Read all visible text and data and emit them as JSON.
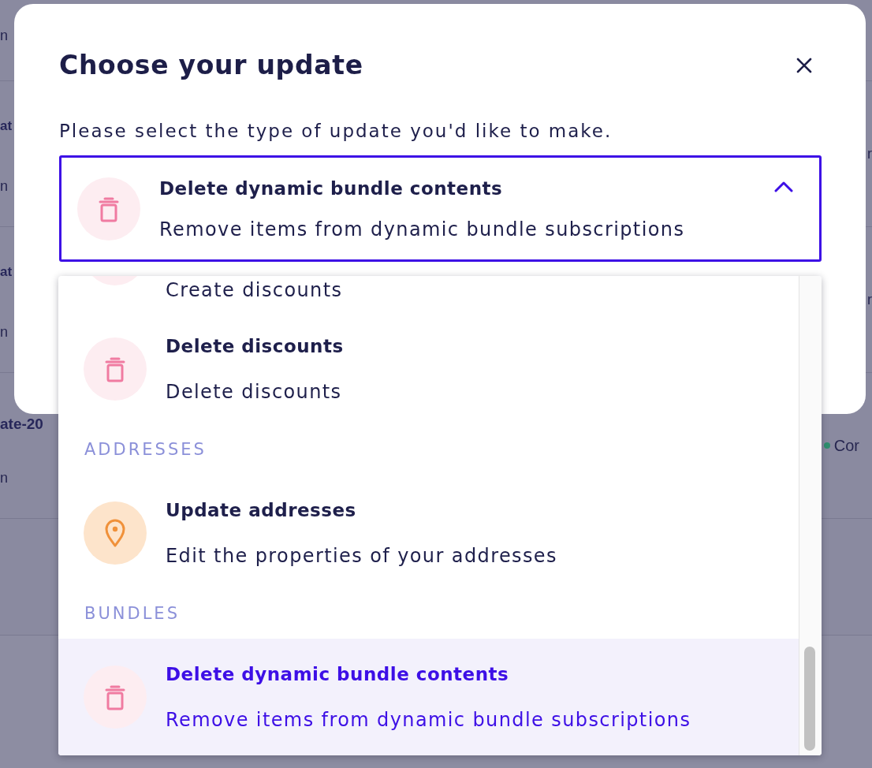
{
  "background_table": {
    "rows": [
      {
        "column_1": {
          "detail": "n"
        }
      },
      {
        "column_1": {
          "title": "at",
          "detail": "n"
        },
        "column_3": "r"
      },
      {
        "column_1": {
          "title": "at",
          "detail": "n"
        },
        "column_3": "r"
      },
      {
        "column_1": {
          "title": "ate-20",
          "detail": "n"
        },
        "status": {
          "label": "Cor",
          "color": "#2f8f6f"
        }
      }
    ]
  },
  "dialog": {
    "title": "Choose your update",
    "prompt": "Please select the type of update you'd like to make.",
    "select": {
      "kind": "delete",
      "title": "Delete dynamic bundle contents",
      "description": "Remove items from dynamic bundle subscriptions",
      "expanded": true
    },
    "options": {
      "sections": [
        {
          "items": [
            {
              "kind": "create",
              "description": "Create discounts",
              "selected": false
            },
            {
              "kind": "delete",
              "title": "Delete discounts",
              "description": "Delete discounts",
              "selected": false
            }
          ]
        },
        {
          "header": "ADDRESSES",
          "items": [
            {
              "kind": "update",
              "title": "Update addresses",
              "description": "Edit the properties of your addresses",
              "selected": false
            }
          ]
        },
        {
          "header": "BUNDLES",
          "items": [
            {
              "kind": "delete",
              "title": "Delete dynamic bundle contents",
              "description": "Remove items from dynamic bundle subscriptions",
              "selected": true
            }
          ]
        }
      ]
    }
  }
}
